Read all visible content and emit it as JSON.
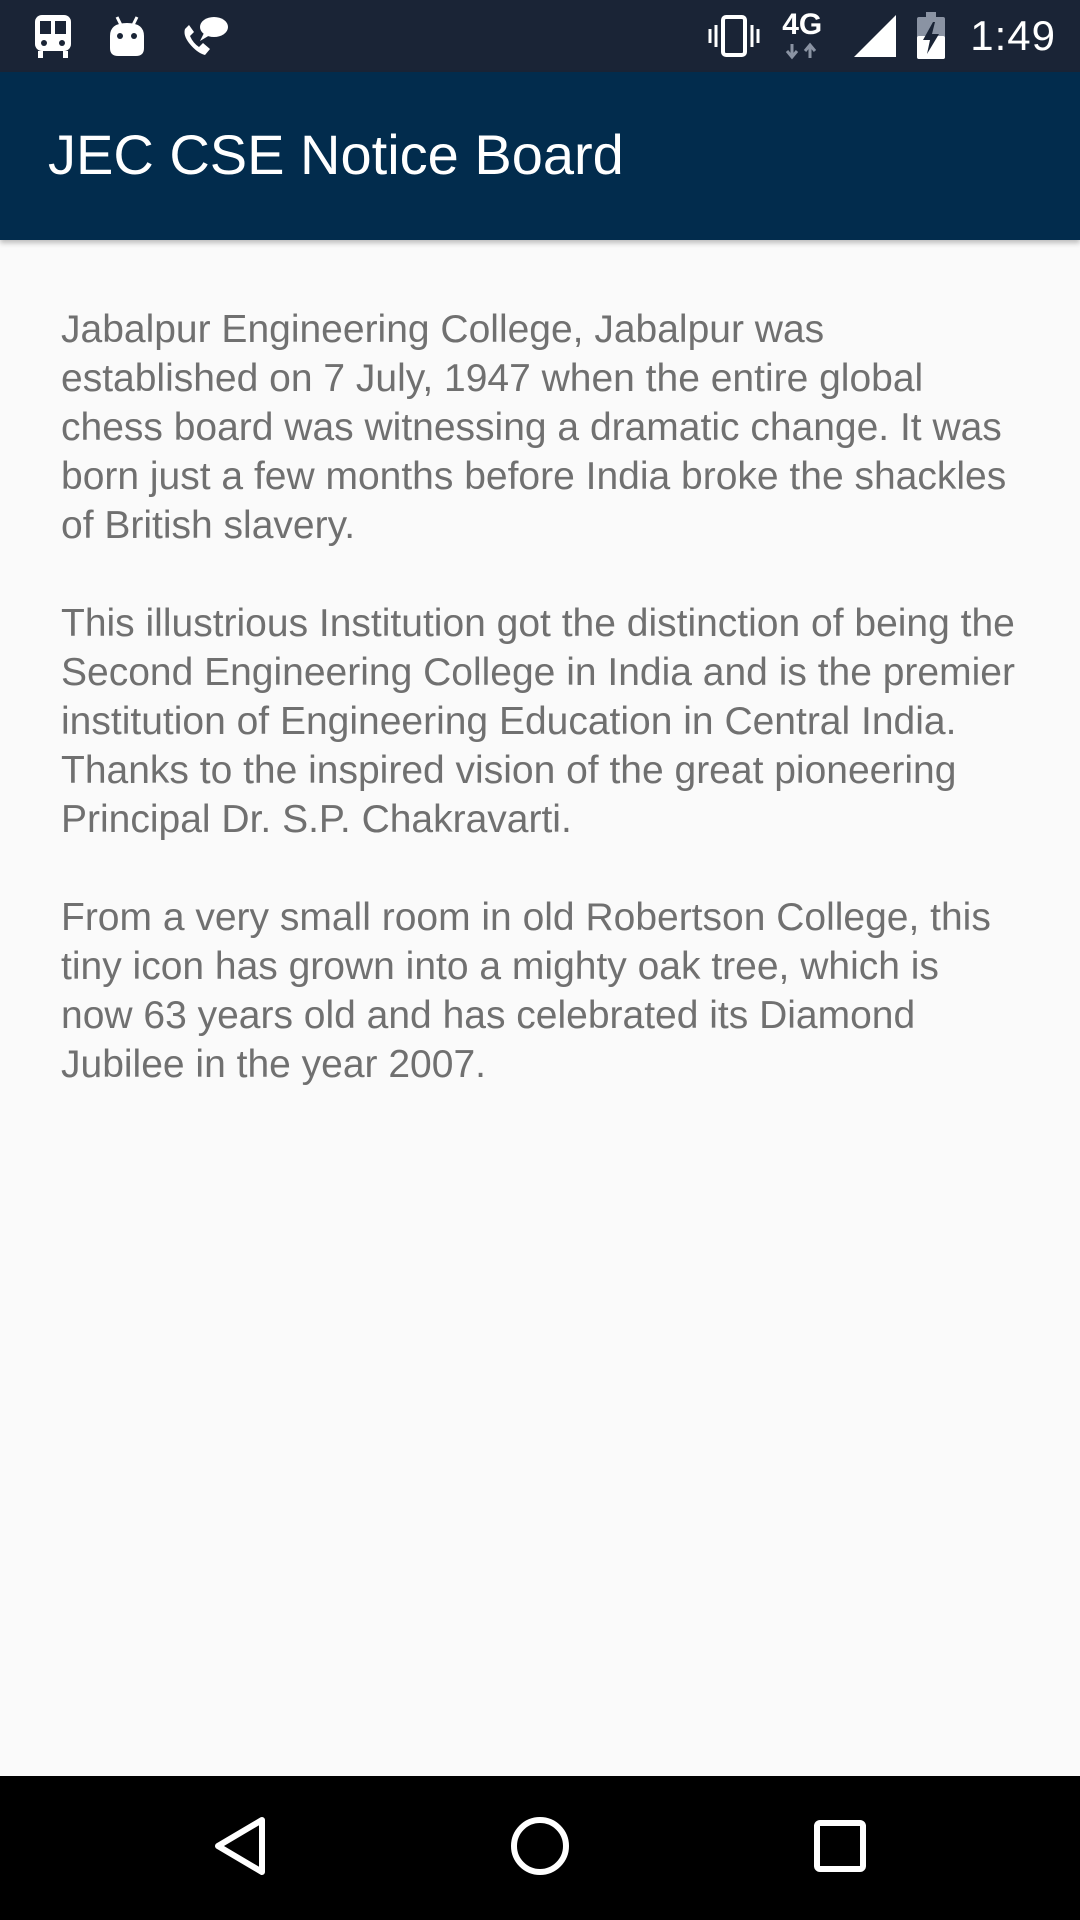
{
  "status_bar": {
    "left_icons": [
      "train-icon",
      "android-icon",
      "phone-chat-icon"
    ],
    "right_icons": [
      "vibrate-icon",
      "network-4g-icon",
      "signal-icon",
      "battery-charging-icon"
    ],
    "network_type": "4G",
    "time": "1:49"
  },
  "app_bar": {
    "title": "JEC CSE Notice Board",
    "color": "#022c4d"
  },
  "content": {
    "paragraphs": [
      "Jabalpur Engineering College, Jabalpur was established on 7 July, 1947 when the entire global chess board was witnessing a dramatic change. It was born just a few months before India broke the shackles of British slavery.",
      "This illustrious Institution got the distinction of being the Second Engineering College in India and is the premier institution of Engineering Education in Central India. Thanks to the inspired vision of the great pioneering Principal Dr. S.P. Chakravarti.",
      "From a very small room in old Robertson College, this tiny icon has grown into a mighty oak tree, which is now 63 years old and has celebrated its Diamond Jubilee in the year 2007."
    ]
  },
  "nav_bar": {
    "buttons": [
      "back-icon",
      "home-icon",
      "recents-icon"
    ]
  }
}
